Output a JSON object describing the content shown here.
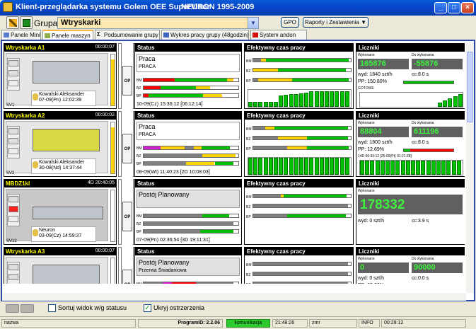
{
  "window": {
    "title": "Klient-przeglądarka systemu Golem OEE SuperVisor",
    "version": "NEURON 1995-2009"
  },
  "toolbar": {
    "group_label": "Grupa",
    "group_value": "Wtryskarki",
    "gpo_label": "GPO",
    "reports_label": "Raporty i Zestawienia"
  },
  "tabs": [
    "Panele Mini",
    "Panele maszyn",
    "Podsumowanie grupy",
    "Wykres pracy grupy (48godzin)",
    "System andon"
  ],
  "panel_labels": {
    "status": "Status",
    "effective": "Efektywny czas pracy",
    "counters": "Liczniki",
    "wykonano": "Wykonano",
    "do_wykonania": "Do wykonania",
    "op": "OP"
  },
  "machines": [
    {
      "name": "Wtryskarka A1",
      "time": "00:00:07",
      "user": "Kowalski Aleksander",
      "login": "07-09(Pn) 12:02:39",
      "sv": "SV1",
      "state": "Praca",
      "substate": "PRACA",
      "stamp": "10-09(Cz) 15:36:12 [06:12:14]",
      "wykonano": "165876",
      "do_wykonania": "-55876",
      "wyd": "wyd: 1840 szt/h",
      "cc": "cc:8.0 s",
      "pp": "PP: 150.80%",
      "extra": "GOTOWE",
      "progress": 1.0
    },
    {
      "name": "Wtryskarka A2",
      "time": "00:00:02",
      "user": "Kowalski Aleksander",
      "login": "30-08(Nd) 14:37:44",
      "sv": "SV2",
      "state": "Praca",
      "substate": "PRACA",
      "stamp": "08-09(Wt) 11:40:23 [2D 10:08:03]",
      "wykonano": "88804",
      "do_wykonania": "611196",
      "wyd": "wyd: 1800 szt/h",
      "cc": "cc:8.0 s",
      "pp": "PP: 12.69%",
      "extra": "14D 00:33:12 [25-09(Pt) 01:21:38]",
      "progress": 0.13
    },
    {
      "name": "MBDZ1kl",
      "time": "4D 20:40:05",
      "user": "Neuron",
      "login": "03-09(Cz) 14:59:37",
      "sv": "SV12",
      "state": "Postój Planowany",
      "substate": "",
      "stamp": "07-09(Pn) 02:36:54 [3D 19:11:31]",
      "wykonano": "178332",
      "do_wykonania": "",
      "wyd": "wyd: 0 szt/h",
      "cc": "cc:3.9 s",
      "pp": "",
      "extra": "",
      "progress": 0
    },
    {
      "name": "Wtryskarka A3",
      "time": "00:00:07",
      "user": "",
      "login": "",
      "sv": "",
      "state": "Postój Planowany",
      "substate": "Przerwa Śniadaniowa",
      "stamp": "",
      "wykonano": "0",
      "do_wykonania": "90000",
      "wyd": "wyd: 0 szt/h",
      "cc": "cc:0.0 s",
      "pp": "PP: 00.00%",
      "extra": "",
      "progress": 0
    }
  ],
  "bottom": {
    "sort_label": "Sortuj widok w/g statusu",
    "hide_label": "Ukryj ostrzerzenia"
  },
  "status": {
    "user": "nazwa",
    "program": "ProgramID: 2.2.06",
    "comm": "komunikacja",
    "time": "21:48:26",
    "zmr": "zmr",
    "info": "INFO",
    "clock": "00:29:12"
  },
  "colors": {
    "work": "#00c000",
    "stop": "#808080",
    "alarm": "#ff0000",
    "warn": "#ffd200",
    "title_bar": "#0545c9"
  }
}
